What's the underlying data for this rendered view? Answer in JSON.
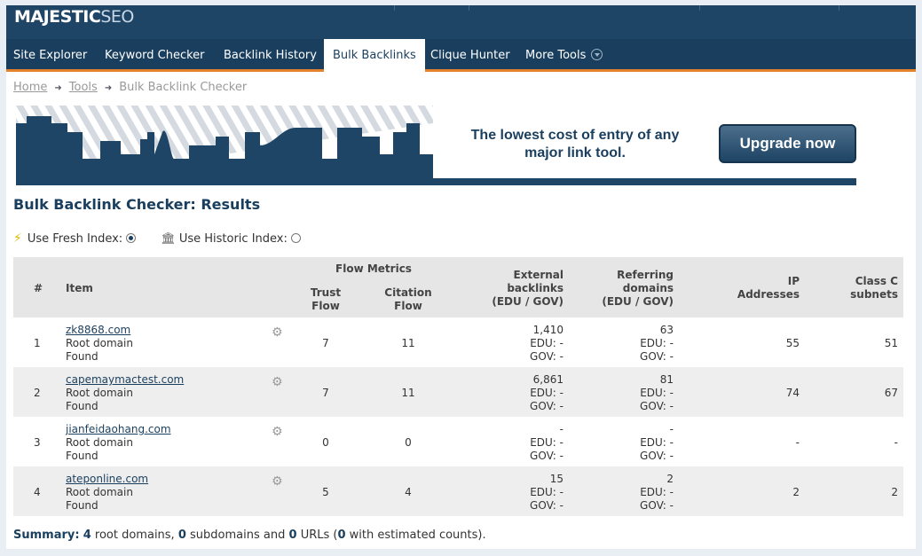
{
  "logo": {
    "main": "MAJESTIC",
    "sub": "SEO"
  },
  "nav": {
    "items": [
      "Site Explorer",
      "Keyword Checker",
      "Backlink History",
      "Bulk Backlinks",
      "Clique Hunter",
      "More Tools"
    ],
    "active": "Bulk Backlinks"
  },
  "breadcrumb": {
    "home": "Home",
    "tools": "Tools",
    "current": "Bulk Backlink Checker",
    "separator": "➜"
  },
  "banner": {
    "line1": "The lowest cost of entry of any",
    "line2": "major link tool.",
    "button": "Upgrade now"
  },
  "page_title": "Bulk Backlink Checker: Results",
  "index": {
    "fresh_label": "Use Fresh Index:",
    "historic_label": "Use Historic Index:",
    "selected": "fresh"
  },
  "table": {
    "headers": {
      "num": "#",
      "item": "Item",
      "flow_metrics": "Flow Metrics",
      "trust_1": "Trust",
      "trust_2": "Flow",
      "citation_1": "Citation",
      "citation_2": "Flow",
      "ext_1": "External",
      "ext_2": "backlinks",
      "ext_3": "(EDU / GOV)",
      "ref_1": "Referring",
      "ref_2": "domains",
      "ref_3": "(EDU / GOV)",
      "ip_1": "IP",
      "ip_2": "Addresses",
      "classc_1": "Class C",
      "classc_2": "subnets"
    },
    "rows": [
      {
        "num": "1",
        "domain": "zk8868.com",
        "type": "Root domain",
        "status": "Found",
        "trust": "7",
        "citation": "11",
        "ext": "1,410",
        "ext_edu": "EDU: -",
        "ext_gov": "GOV: -",
        "ref": "63",
        "ref_edu": "EDU: -",
        "ref_gov": "GOV: -",
        "ip": "55",
        "classc": "51"
      },
      {
        "num": "2",
        "domain": "capemaymactest.com",
        "type": "Root domain",
        "status": "Found",
        "trust": "7",
        "citation": "11",
        "ext": "6,861",
        "ext_edu": "EDU: -",
        "ext_gov": "GOV: -",
        "ref": "81",
        "ref_edu": "EDU: -",
        "ref_gov": "GOV: -",
        "ip": "74",
        "classc": "67"
      },
      {
        "num": "3",
        "domain": "jianfeidaohang.com",
        "type": "Root domain",
        "status": "Found",
        "trust": "0",
        "citation": "0",
        "ext": "-",
        "ext_edu": "EDU: -",
        "ext_gov": "GOV: -",
        "ref": "-",
        "ref_edu": "EDU: -",
        "ref_gov": "GOV: -",
        "ip": "-",
        "classc": "-"
      },
      {
        "num": "4",
        "domain": "ateponline.com",
        "type": "Root domain",
        "status": "Found",
        "trust": "5",
        "citation": "4",
        "ext": "15",
        "ext_edu": "EDU: -",
        "ext_gov": "GOV: -",
        "ref": "2",
        "ref_edu": "EDU: -",
        "ref_gov": "GOV: -",
        "ip": "2",
        "classc": "2"
      }
    ]
  },
  "summary": {
    "label": "Summary:",
    "root_count": "4",
    "root_text": "root domains,",
    "sub_count": "0",
    "sub_text": "subdomains and",
    "url_count": "0",
    "url_text": "URLs (",
    "est_count": "0",
    "est_text": "with estimated counts)."
  },
  "colors": {
    "nav_bg": "#1a3f5e",
    "accent": "#e3822a",
    "title": "#1a3f5e"
  }
}
